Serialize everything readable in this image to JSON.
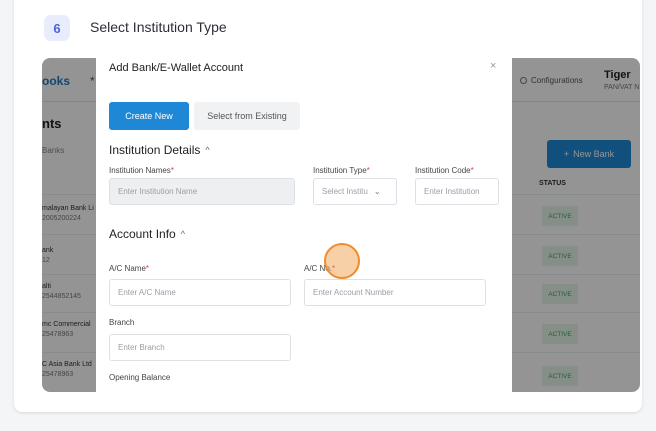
{
  "step": {
    "number": "6",
    "title": "Select Institution Type"
  },
  "background_app": {
    "brand": "ooks",
    "brand_marker": "*",
    "config_label": "Configurations",
    "user_name": "Tiger",
    "user_sub": "PAN/VAT N",
    "page_heading": "nts",
    "page_subheading": "Banks",
    "new_bank_label": "New Bank",
    "status_header": "STATUS",
    "rows": [
      {
        "name": "malayan Bank Li",
        "sub": "2005200224",
        "status": "ACTIVE"
      },
      {
        "name": "ank",
        "sub": "12",
        "status": "ACTIVE"
      },
      {
        "name": "alti",
        "sub": "2544852145",
        "status": "ACTIVE"
      },
      {
        "name": "mc Commercial",
        "sub": "25478963",
        "status": "ACTIVE"
      },
      {
        "name": "C Asia Bank Ltd",
        "sub": "25478963",
        "status": "ACTIVE"
      }
    ]
  },
  "modal": {
    "title": "Add Bank/E-Wallet Account",
    "close_glyph": "×",
    "tab_create": "Create New",
    "tab_existing": "Select from Existing",
    "institution_section": "Institution Details",
    "account_section": "Account Info",
    "chevron_up": "^",
    "fields": {
      "institution_names": {
        "label": "Institution Names",
        "placeholder": "Enter Institution Name"
      },
      "institution_type": {
        "label": "Institution Type",
        "placeholder": "Select Institu"
      },
      "institution_code": {
        "label": "Institution Code",
        "placeholder": "Enter Institution"
      },
      "ac_name": {
        "label": "A/C Name",
        "placeholder": "Enter A/C Name"
      },
      "ac_no": {
        "label": "A/C No.",
        "placeholder": "Enter Account Number"
      },
      "branch": {
        "label": "Branch",
        "placeholder": "Enter Branch"
      },
      "opening_balance": {
        "label": "Opening Balance"
      }
    },
    "required_mark": "*",
    "select_arrow": "⌄"
  },
  "colors": {
    "primary": "#1e88d6",
    "accent": "#4a63d9",
    "required": "#e0344c",
    "highlight": "#f08c2c"
  }
}
